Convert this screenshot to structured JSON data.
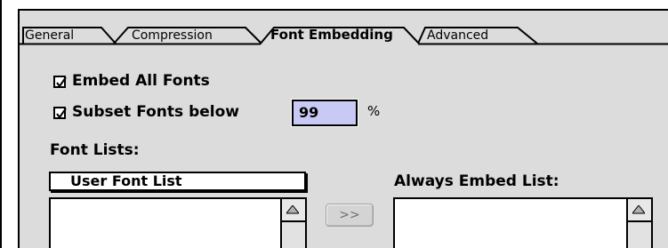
{
  "tabs": [
    {
      "label": "General",
      "active": false
    },
    {
      "label": "Compression",
      "active": false
    },
    {
      "label": "Font Embedding",
      "active": true
    },
    {
      "label": "Advanced",
      "active": false
    }
  ],
  "options": {
    "embed_all_fonts": {
      "label": "Embed All Fonts",
      "checked": true
    },
    "subset_fonts": {
      "label": "Subset Fonts below",
      "checked": true,
      "value": "99",
      "unit": "%"
    }
  },
  "font_lists": {
    "heading": "Font Lists:",
    "user_font_list_label": "User Font List",
    "move_button_label": ">>",
    "always_embed_label": "Always Embed List:"
  },
  "colors": {
    "panel_bg": "#dcdcdc",
    "input_bg": "#c9c9f5"
  }
}
